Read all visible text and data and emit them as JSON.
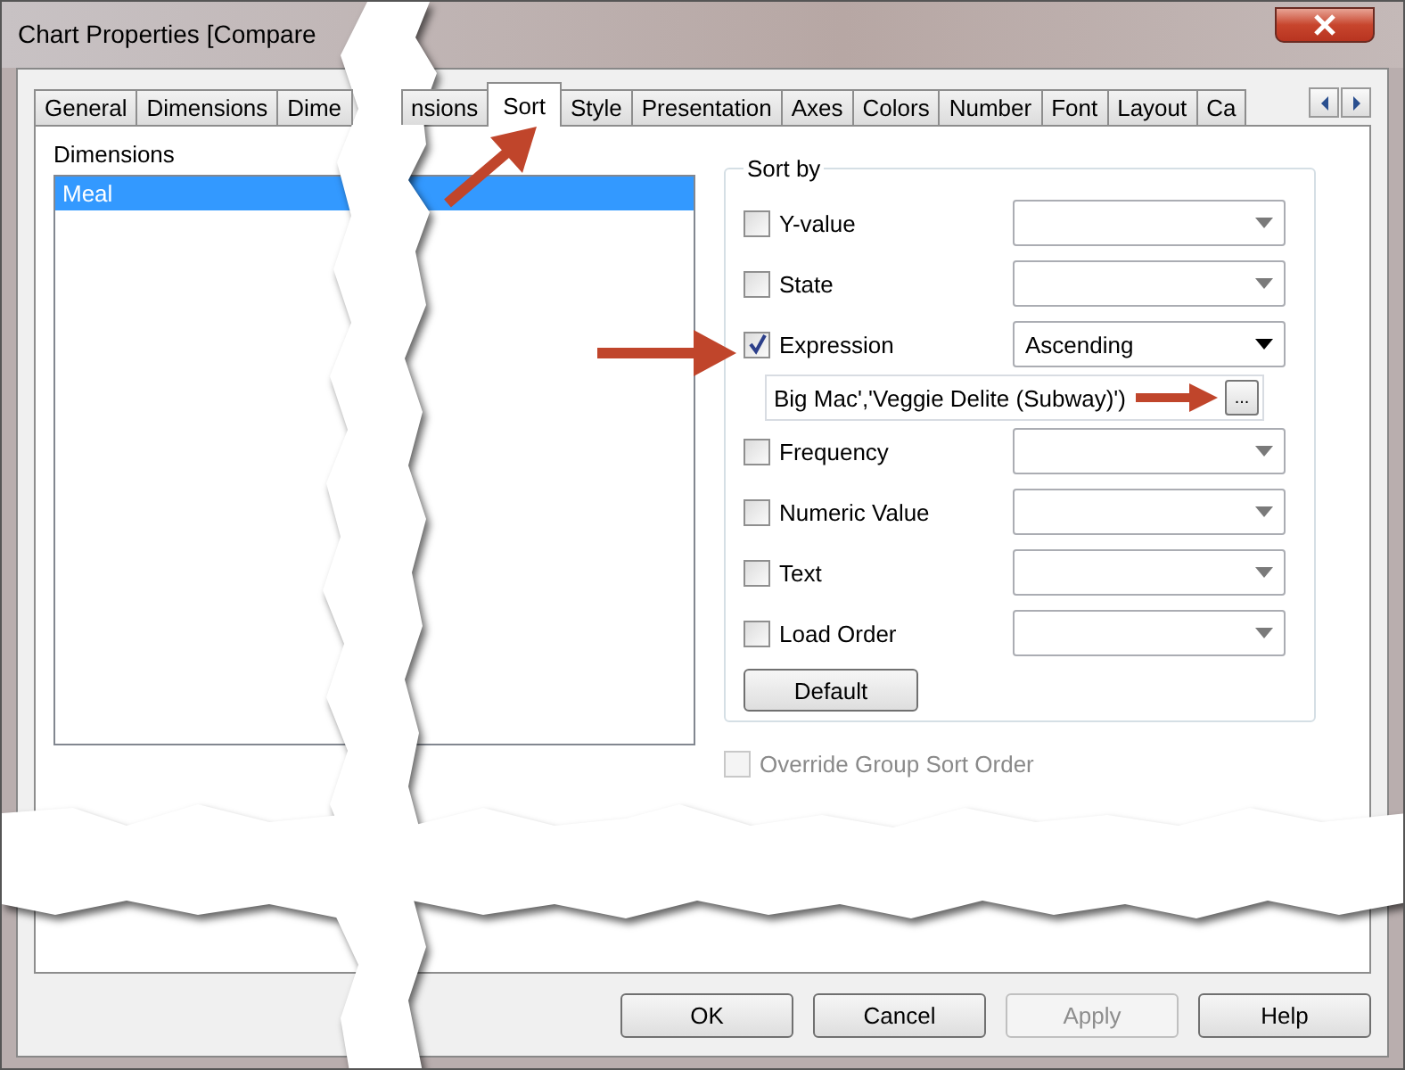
{
  "window": {
    "title": "Chart Properties [Compare"
  },
  "tabs": [
    {
      "label": "General",
      "selected": false
    },
    {
      "label": "Dimensions",
      "selected": false
    },
    {
      "label": "Dime",
      "selected": false,
      "cut": true
    },
    {
      "label": "nsions",
      "selected": false
    },
    {
      "label": "Sort",
      "selected": true
    },
    {
      "label": "Style",
      "selected": false
    },
    {
      "label": "Presentation",
      "selected": false
    },
    {
      "label": "Axes",
      "selected": false
    },
    {
      "label": "Colors",
      "selected": false
    },
    {
      "label": "Number",
      "selected": false
    },
    {
      "label": "Font",
      "selected": false
    },
    {
      "label": "Layout",
      "selected": false
    },
    {
      "label": "Ca",
      "selected": false
    }
  ],
  "dimensions": {
    "label": "Dimensions",
    "items": [
      {
        "label": "Meal",
        "selected": true
      }
    ]
  },
  "sort_by": {
    "title": "Sort by",
    "options": [
      {
        "label": "Y-value",
        "checked": false
      },
      {
        "label": "State",
        "checked": false
      },
      {
        "label": "Expression",
        "checked": true,
        "value": "Ascending",
        "expression": "Big Mac','Veggie Delite (Subway)')",
        "expression_button": "..."
      },
      {
        "label": "Frequency",
        "checked": false
      },
      {
        "label": "Numeric Value",
        "checked": false
      },
      {
        "label": "Text",
        "checked": false
      },
      {
        "label": "Load Order",
        "checked": false
      }
    ],
    "default_button": "Default"
  },
  "override": {
    "label": "Override Group Sort Order",
    "checked": false,
    "disabled": true
  },
  "buttons": [
    {
      "label": "OK",
      "disabled": false
    },
    {
      "label": "Cancel",
      "disabled": false
    },
    {
      "label": "Apply",
      "disabled": true
    },
    {
      "label": "Help",
      "disabled": false
    }
  ]
}
